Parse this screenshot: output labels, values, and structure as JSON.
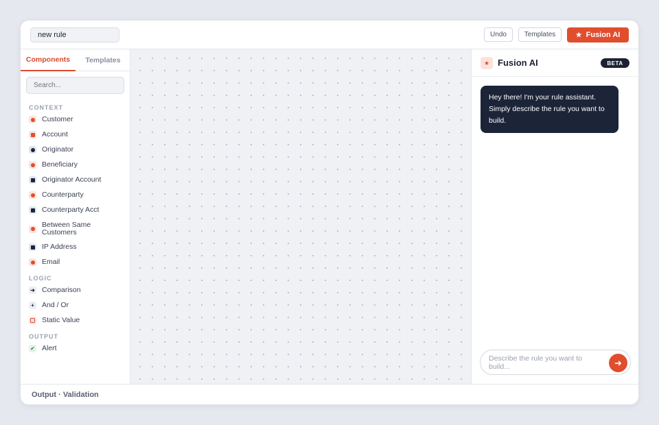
{
  "topbar": {
    "rule_name": "new rule",
    "undo_label": "Undo",
    "templates_label": "Templates",
    "fusion_label": "Fusion AI",
    "fusion_icon": "star-icon"
  },
  "left_panel": {
    "tabs": [
      {
        "label": "Components",
        "active": true
      },
      {
        "label": "Templates",
        "active": false
      }
    ],
    "search_placeholder": "Search...",
    "sections": {
      "context": "CONTEXT",
      "logic": "LOGIC",
      "output": "OUTPUT"
    },
    "context_items": [
      {
        "label": "Customer",
        "icon": "customer-icon",
        "color": "#e04e2e"
      },
      {
        "label": "Account",
        "icon": "account-icon",
        "color": "#e04e2e"
      },
      {
        "label": "Originator",
        "icon": "originator-icon",
        "color": "#1c2540"
      },
      {
        "label": "Beneficiary",
        "icon": "beneficiary-icon",
        "color": "#e04e2e"
      },
      {
        "label": "Originator Account",
        "icon": "originator-account-icon",
        "color": "#1c2540"
      },
      {
        "label": "Counterparty",
        "icon": "counterparty-icon",
        "color": "#e04e2e"
      },
      {
        "label": "Counterparty Acct",
        "icon": "counterparty-acct-icon",
        "color": "#1c2540"
      },
      {
        "label": "Between Same Customers",
        "icon": "between-customers-icon",
        "color": "#e04e2e"
      },
      {
        "label": "IP Address",
        "icon": "ip-address-icon",
        "color": "#1c2540"
      },
      {
        "label": "Email",
        "icon": "email-icon",
        "color": "#e04e2e"
      }
    ],
    "logic_items": [
      {
        "label": "Comparison",
        "icon": "arrow-right-icon"
      },
      {
        "label": "And / Or",
        "icon": "plus-icon"
      },
      {
        "label": "Static Value",
        "icon": "static-value-icon"
      }
    ],
    "output_items": [
      {
        "label": "Alert",
        "icon": "check-icon"
      }
    ]
  },
  "assistant": {
    "title": "Fusion AI",
    "badge": "BETA",
    "message": "Hey there! I'm your rule assistant. Simply describe the rule you want to build.",
    "input_placeholder": "Describe the rule you want to build...",
    "send_icon": "send-arrow-icon"
  },
  "bottombar": {
    "label": "Output · Validation"
  },
  "colors": {
    "accent": "#e04e2e",
    "navy": "#1c2438",
    "canvas": "#f0f1f5"
  }
}
